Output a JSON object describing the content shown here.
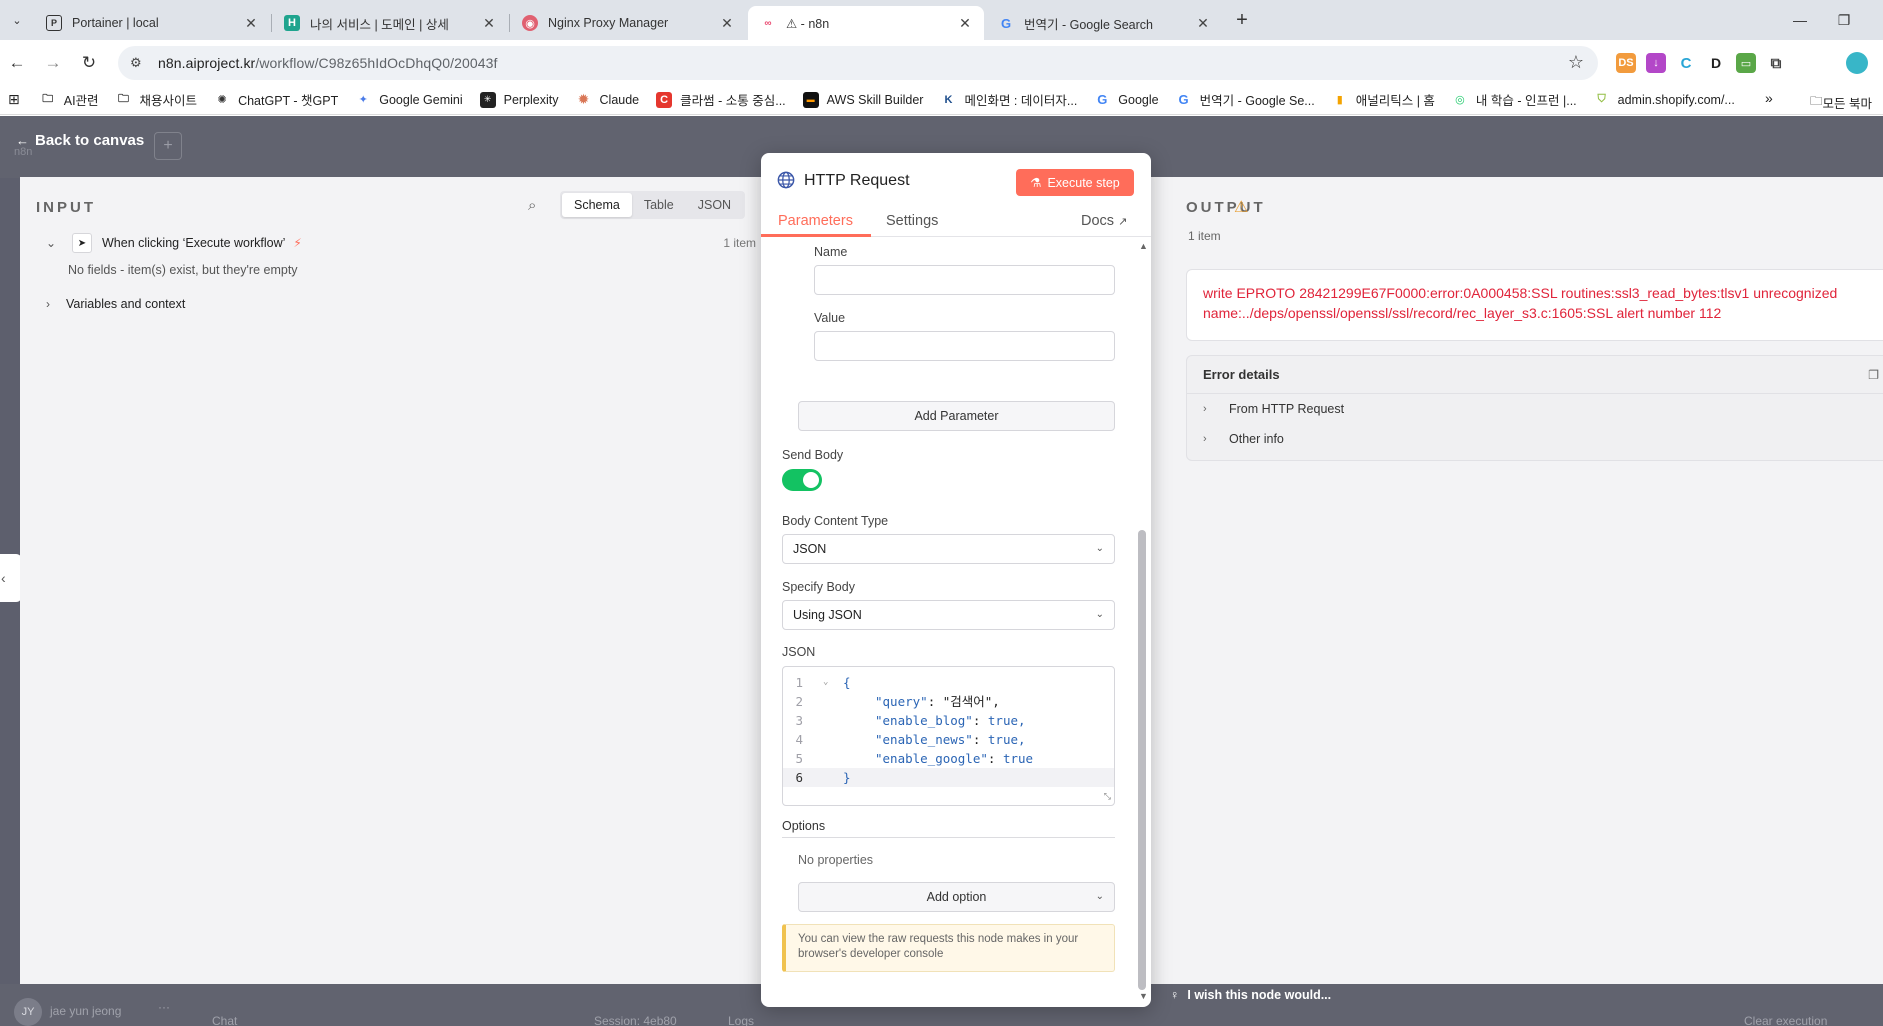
{
  "browser": {
    "tabs": [
      {
        "title": "Portainer | local",
        "icon": "portainer-icon",
        "active": false
      },
      {
        "title": "나의 서비스 | 도메인 | 상세",
        "icon": "h-icon",
        "active": false
      },
      {
        "title": "Nginx Proxy Manager",
        "icon": "nginx-proxy-icon",
        "active": false
      },
      {
        "title": "⚠ - n8n",
        "icon": "n8n-icon",
        "active": true
      },
      {
        "title": "번역기 - Google Search",
        "icon": "google-icon",
        "active": false
      }
    ],
    "url_host": "n8n.aiproject.kr",
    "url_path": "/workflow/C98z65hIdOcDhqQ0/20043f",
    "bookmarks": [
      {
        "label": "AI관련",
        "icon": "folder-icon"
      },
      {
        "label": "채용사이트",
        "icon": "folder-icon"
      },
      {
        "label": "ChatGPT - 챗GPT",
        "icon": "chatgpt-icon"
      },
      {
        "label": "Google Gemini",
        "icon": "gemini-icon"
      },
      {
        "label": "Perplexity",
        "icon": "perplexity-icon"
      },
      {
        "label": "Claude",
        "icon": "claude-icon"
      },
      {
        "label": "클라썸 - 소통 중심...",
        "icon": "classum-icon"
      },
      {
        "label": "AWS Skill Builder",
        "icon": "aws-icon"
      },
      {
        "label": "메인화면 : 데이터자...",
        "icon": "kdata-icon"
      },
      {
        "label": "Google",
        "icon": "google-icon"
      },
      {
        "label": "번역기 - Google Se...",
        "icon": "google-icon"
      },
      {
        "label": "애널리틱스 | 홈",
        "icon": "analytics-icon"
      },
      {
        "label": "내 학습 - 인프런 |...",
        "icon": "inflearn-icon"
      },
      {
        "label": "admin.shopify.com/...",
        "icon": "shopify-icon"
      }
    ],
    "all_bookmarks_label": "모든 북마"
  },
  "app": {
    "back_label": "Back to canvas",
    "logo_text": "n8n",
    "user_initials": "JY",
    "user_name": "jae yun jeong",
    "chat_label": "Chat",
    "session_label": "Session: 4eb80",
    "logs_label": "Logs",
    "clear_label": "Clear execution",
    "wish_label": "I wish this node would..."
  },
  "input": {
    "title": "INPUT",
    "views": [
      "Schema",
      "Table",
      "JSON"
    ],
    "trigger_label": "When clicking ‘Execute workflow’",
    "item_count": "1 item",
    "no_fields": "No fields - item(s) exist, but they're empty",
    "vars_label": "Variables and context"
  },
  "node": {
    "title": "HTTP Request",
    "execute_label": "Execute step",
    "tabs": {
      "parameters": "Parameters",
      "settings": "Settings",
      "docs": "Docs"
    },
    "name_label": "Name",
    "name_value": "",
    "value_label": "Value",
    "value_value": "",
    "add_parameter": "Add Parameter",
    "send_body_label": "Send Body",
    "send_body_on": true,
    "body_content_type_label": "Body Content Type",
    "body_content_type": "JSON",
    "specify_body_label": "Specify Body",
    "specify_body": "Using JSON",
    "json_label": "JSON",
    "json_lines": [
      {
        "n": "1",
        "text": "{"
      },
      {
        "n": "2",
        "key": "\"query\"",
        "val": "\"검색어\","
      },
      {
        "n": "3",
        "key": "\"enable_blog\"",
        "val": "true,"
      },
      {
        "n": "4",
        "key": "\"enable_news\"",
        "val": "true,"
      },
      {
        "n": "5",
        "key": "\"enable_google\"",
        "val": "true"
      },
      {
        "n": "6",
        "text": "}"
      }
    ],
    "options_label": "Options",
    "no_properties": "No properties",
    "add_option": "Add option",
    "notice": "You can view the raw requests this node makes in your browser's developer console"
  },
  "output": {
    "title": "OUTPUT",
    "item_count": "1 item",
    "error_message": "write EPROTO 28421299E67F0000:error:0A000458:SSL routines:ssl3_read_bytes:tlsv1 unrecognized name:../deps/openssl/openssl/ssl/record/rec_layer_s3.c:1605:SSL alert number 112",
    "error_details_label": "Error details",
    "details_rows": [
      "From HTTP Request",
      "Other info"
    ]
  },
  "colors": {
    "accent": "#ff6d5a",
    "toggle_on": "#13c262",
    "error": "#e0243a",
    "warning": "#e8a23a"
  }
}
